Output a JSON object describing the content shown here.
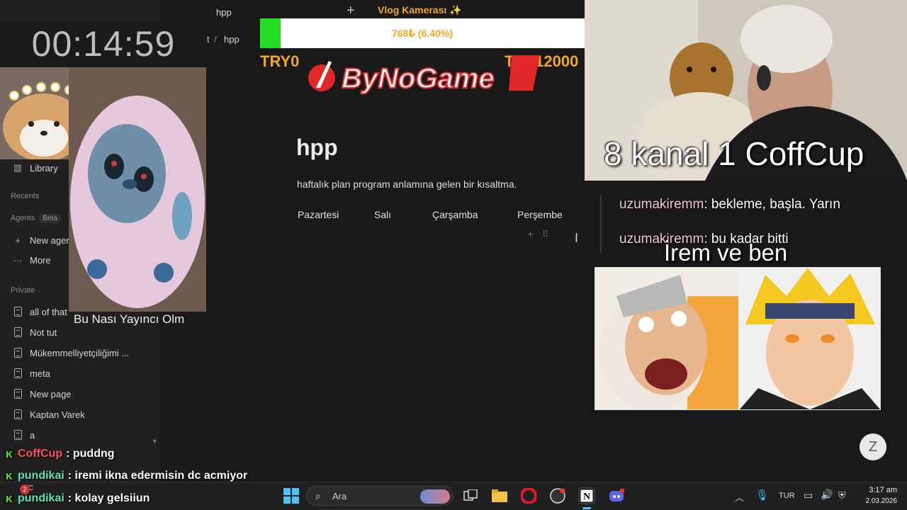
{
  "timer": "00:14:59",
  "plush_caption": "Bu Nası Yayıncı Olm",
  "sidebar": {
    "library": "Library",
    "recents": "Recents",
    "agents": "Agents",
    "agents_badge": "Beta",
    "new_agent": "New agen",
    "more": "More",
    "private": "Private",
    "pages": [
      "all of that",
      "Not tut",
      "Mükemmelliyetçiliğimi ...",
      "meta",
      "New page",
      "Kaptan Varek",
      "a"
    ]
  },
  "tab": {
    "title": "hpp",
    "add": "+"
  },
  "breadcrumb": {
    "sep": "/",
    "current": "hpp",
    "partial": "t"
  },
  "donation": {
    "title": "Vlog Kamerası ✨",
    "amount": "768₺ (6.40%)",
    "fill_percent": 6.4,
    "min": "TRY0",
    "max": "TRY12000",
    "brand": "ByNoGame",
    "bar_color": "#22dd22"
  },
  "page": {
    "title": "hpp",
    "description": "haftalık plan program anlamına gelen bir kısaltma.",
    "days": [
      "Pazartesi",
      "Salı",
      "Çarşamba",
      "Perşembe"
    ]
  },
  "stream": {
    "cam_title": "8 kanal 1 CoffCup",
    "overlay_title": "İrem ve ben"
  },
  "chat_right": [
    {
      "user": "uzumakiremm",
      "message": ": bekleme, başla. Yarın"
    },
    {
      "user": "uzumakiremm",
      "message": ": bu kadar bitti"
    }
  ],
  "chat_bottom": [
    {
      "user": "CoffCup",
      "message": ": puddng",
      "color": "#ff4d6a"
    },
    {
      "user": "pundikai",
      "message": ": iremi ikna edermisin dc acmiyor",
      "color": "#59e0c0"
    },
    {
      "user": "pundikai",
      "message": ": kolay gelsiiun",
      "color": "#59e0c0"
    }
  ],
  "taskbar": {
    "search_placeholder": "Ara",
    "weather": "1°C",
    "weather_badge": "2",
    "lang": "TUR",
    "time": "3:17 am",
    "date": "2.03.2026"
  }
}
